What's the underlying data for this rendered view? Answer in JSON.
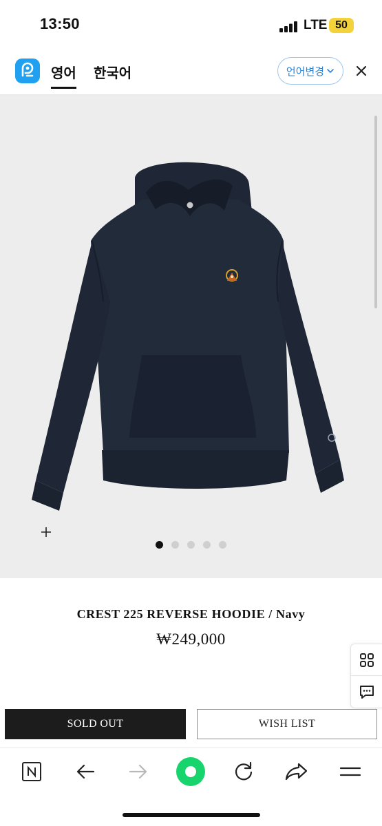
{
  "status_bar": {
    "time": "13:50",
    "network": "LTE",
    "battery": "50"
  },
  "translate_bar": {
    "active_language": "영어",
    "inactive_language": "한국어",
    "change_language_label": "언어변경",
    "accent_color": "#2a84d8"
  },
  "gallery": {
    "image_count": 5,
    "active_index": 0
  },
  "product": {
    "name": "CREST 225 REVERSE HOODIE / Navy",
    "price": "₩249,000",
    "image_color": "#1f2736"
  },
  "actions": {
    "sold_out_label": "SOLD OUT",
    "wish_list_label": "WISH LIST"
  },
  "side_buttons": [
    "grid-icon",
    "chat-icon"
  ],
  "toolbar": [
    "naver-home-icon",
    "back-arrow-icon",
    "forward-arrow-icon",
    "green-dot-icon",
    "refresh-icon",
    "share-icon",
    "menu-icon"
  ]
}
